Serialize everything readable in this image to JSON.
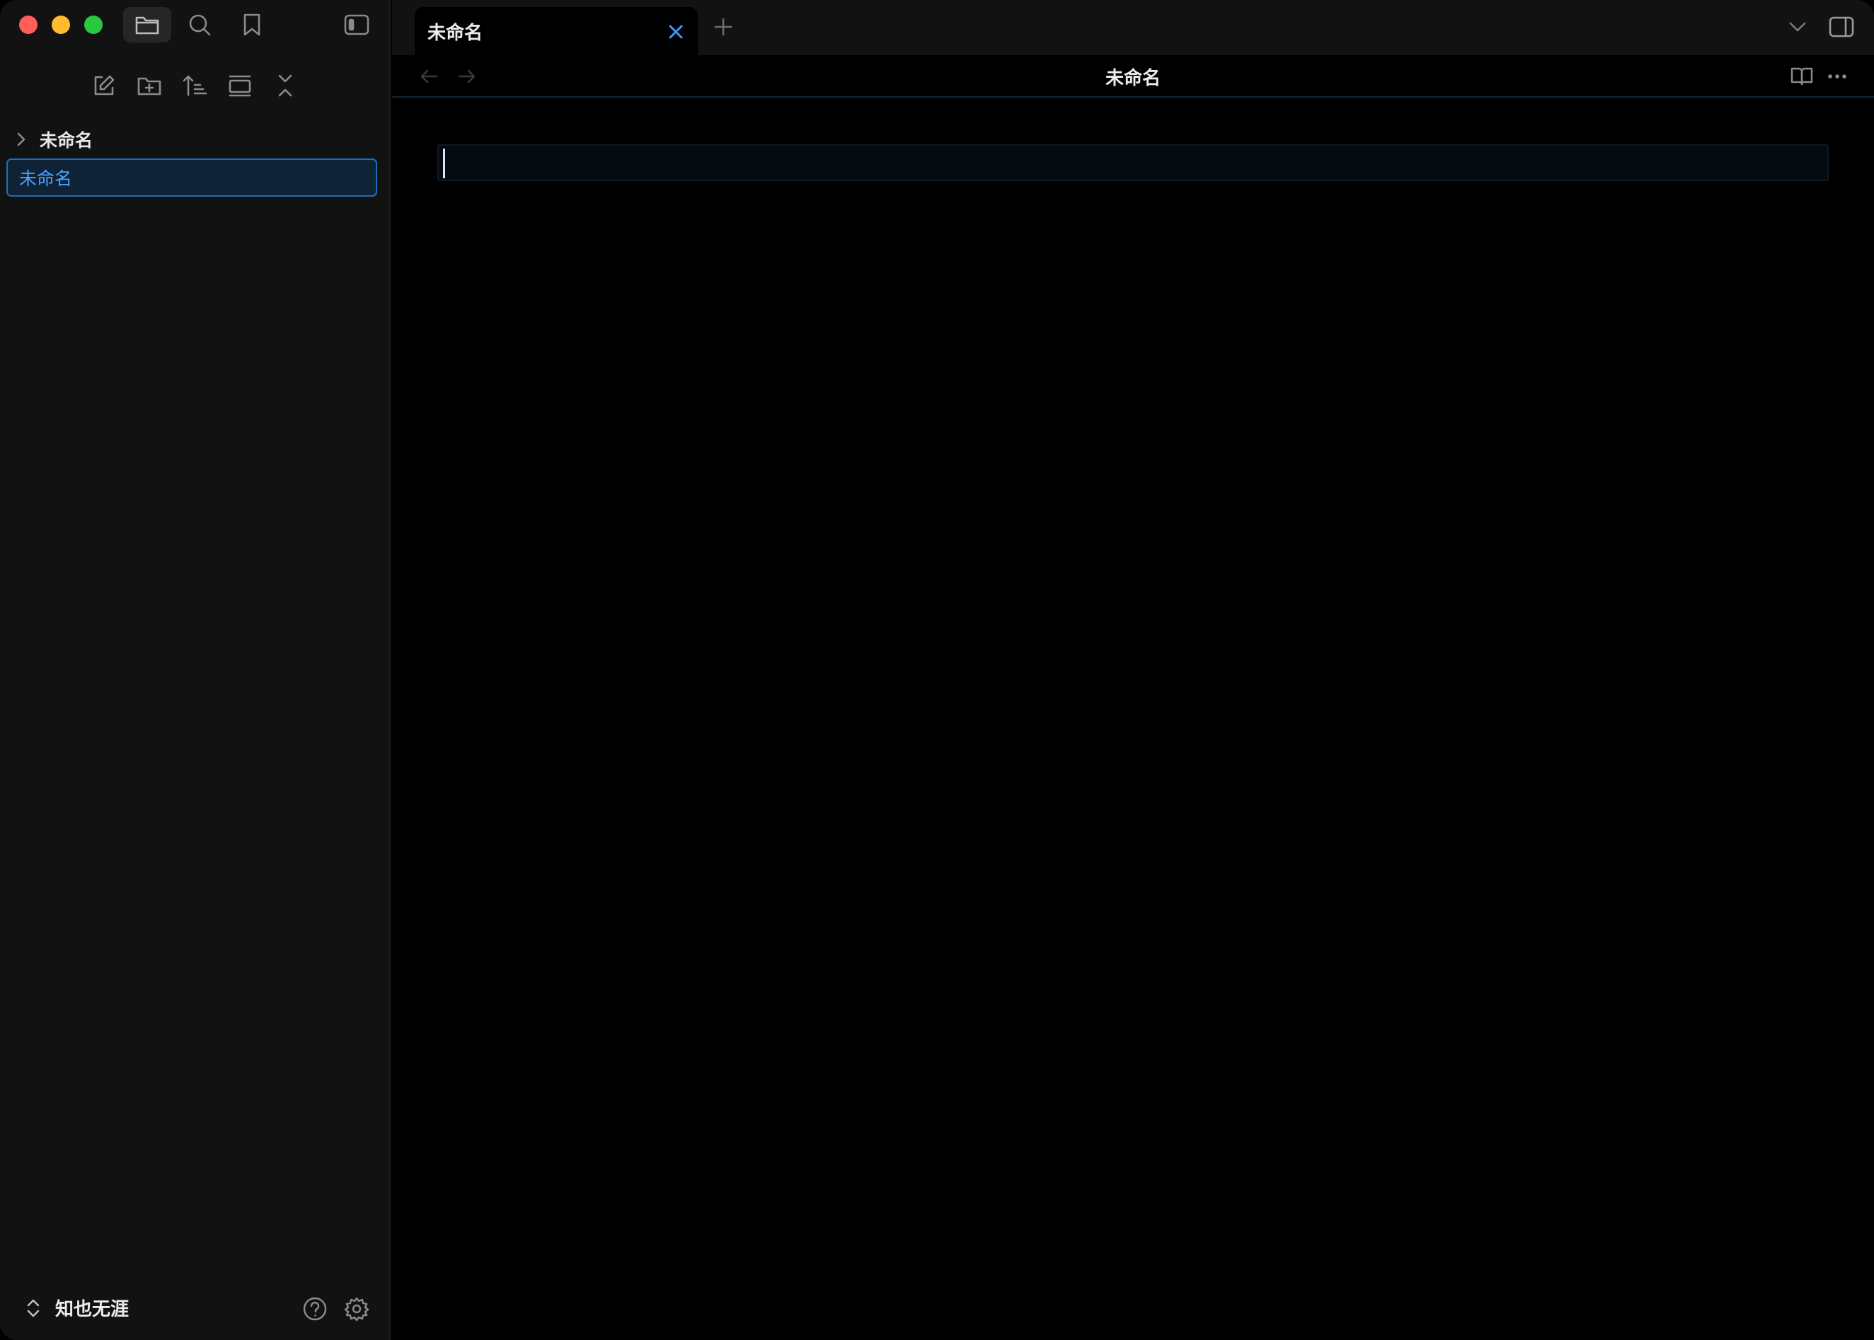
{
  "window": {
    "traffic_lights": [
      "close",
      "minimize",
      "zoom"
    ]
  },
  "sidebar": {
    "ribbon_icons": [
      "folder-icon",
      "search-icon",
      "bookmark-icon",
      "sidebar-left-icon"
    ],
    "toolbar_icons": [
      "new-note-icon",
      "new-folder-icon",
      "sort-icon",
      "collapse-icon",
      "close-all-icon"
    ],
    "tree": {
      "folder_label": "未命名",
      "file_label": "未命名"
    },
    "footer": {
      "vault_name": "知也无涯"
    }
  },
  "tabs": {
    "active_label": "未命名"
  },
  "view": {
    "title": "未命名"
  },
  "colors": {
    "accent": "#3d9bff",
    "sidebar_bg": "#121212",
    "editor_bg": "#000000",
    "selection_bg": "#0f2236"
  }
}
